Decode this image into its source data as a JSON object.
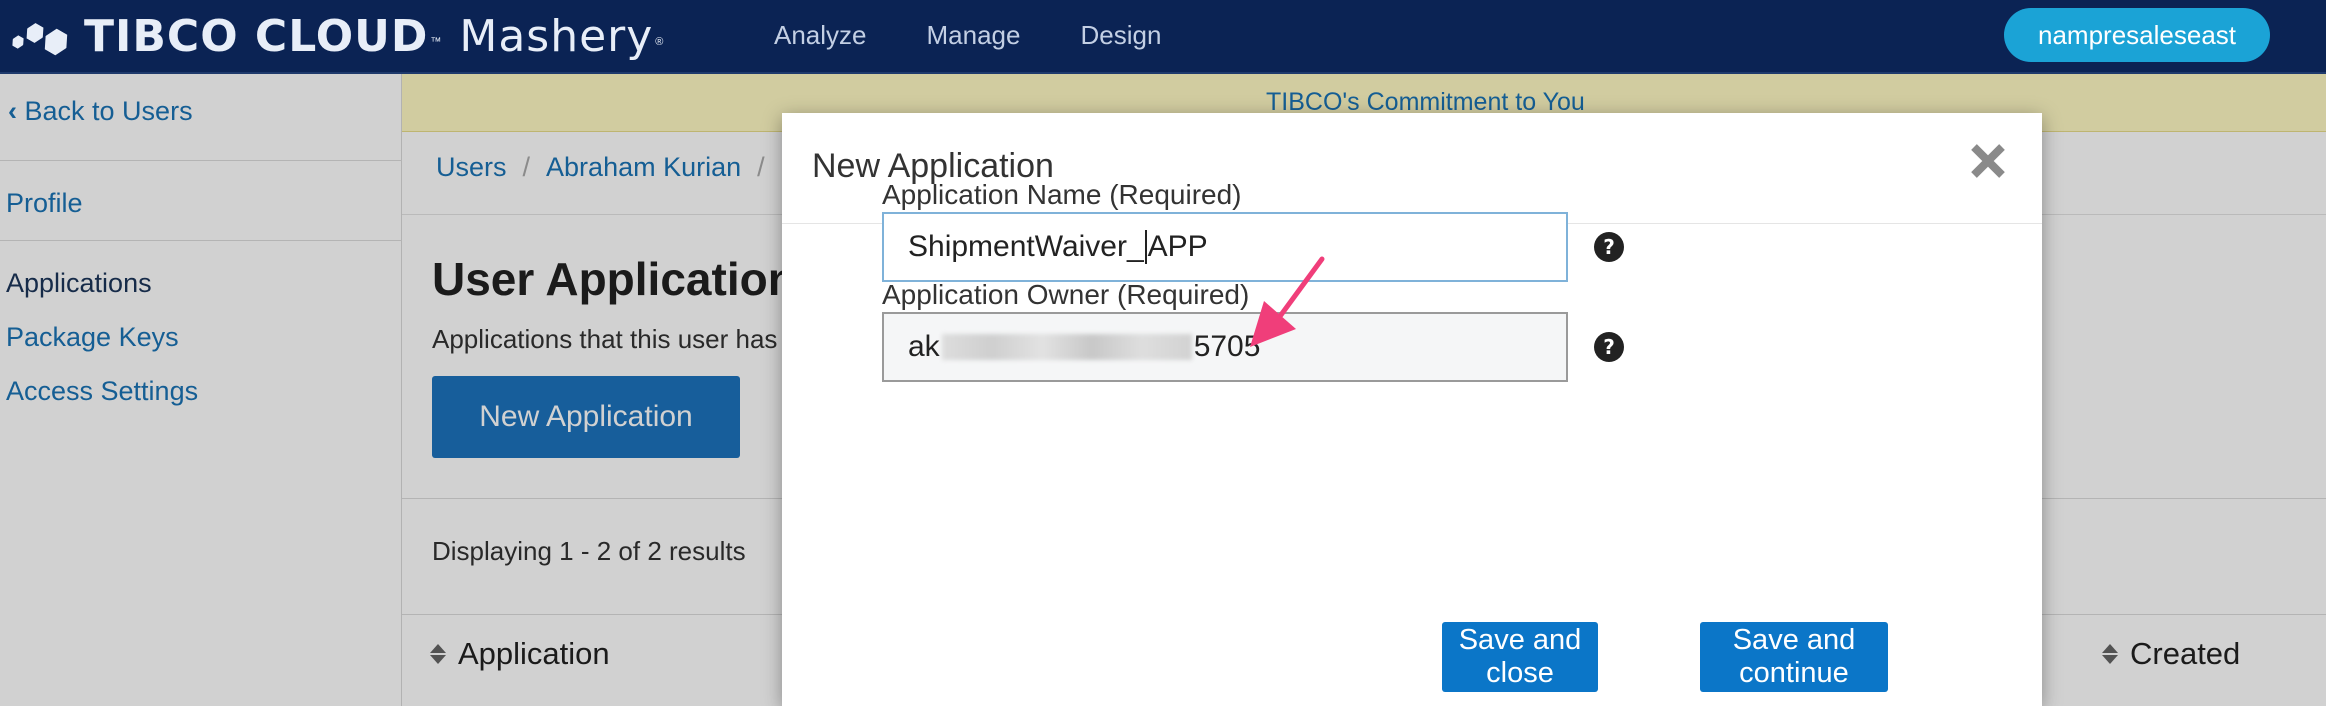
{
  "topnav": {
    "brand": "TIBCO CLOUD",
    "brand_tm": "™",
    "product": "Mashery",
    "product_reg": "®",
    "links": [
      "Analyze",
      "Manage",
      "Design"
    ],
    "user": "nampresaleseast"
  },
  "sidebar": {
    "back_label": "Back to Users",
    "items": [
      {
        "label": "Profile"
      },
      {
        "label": "Applications"
      },
      {
        "label": "Package Keys"
      },
      {
        "label": "Access Settings"
      }
    ]
  },
  "main": {
    "banner": "TIBCO's Commitment to You",
    "breadcrumb": [
      "Users",
      "Abraham Kurian"
    ],
    "title": "User Applications",
    "subtitle": "Applications that this user has",
    "new_app_button": "New Application",
    "display_count": "Displaying 1 - 2 of 2 results",
    "columns": {
      "application": "Application",
      "created": "Created"
    }
  },
  "modal": {
    "title": "New Application",
    "name_label": "Application Name (Required)",
    "name_value_before_caret": "ShipmentWaiver_",
    "name_value_after_caret": "APP",
    "owner_label": "Application Owner (Required)",
    "owner_value_prefix": "ak",
    "owner_value_suffix": "5705",
    "help_glyph": "?",
    "save_close": "Save and close",
    "save_continue": "Save and continue"
  },
  "colors": {
    "nav_bg": "#0b2354",
    "accent": "#1a73b5",
    "button": "#0b76c8",
    "user_pill": "#1ba3d6",
    "arrow": "#f03e7a"
  }
}
